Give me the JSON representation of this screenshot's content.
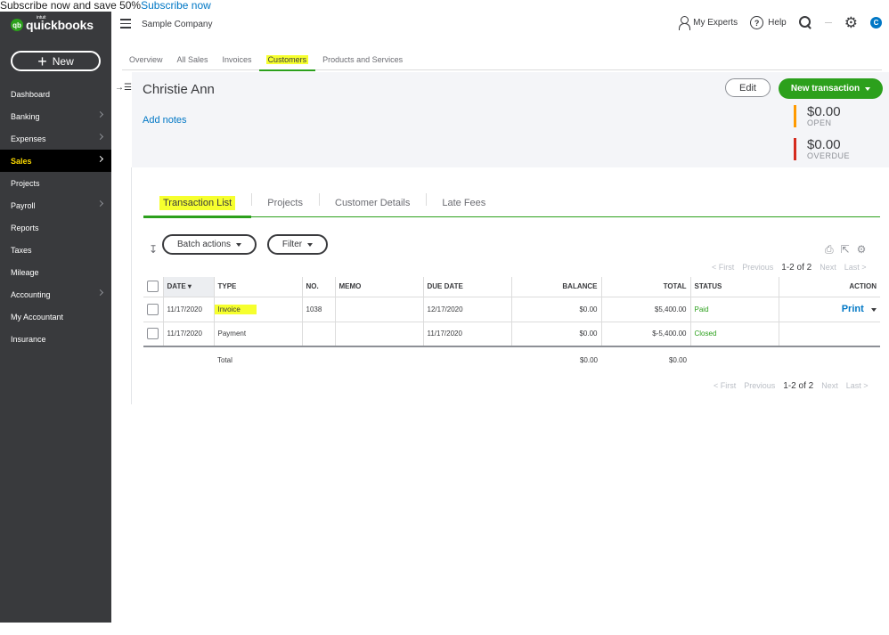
{
  "promo": {
    "text": "Subscribe now and save 50%",
    "link": "Subscribe now"
  },
  "brand": {
    "logo": "quickbooks",
    "intuit": "intuit",
    "badge": "qb"
  },
  "sidebar": {
    "new_button": "New",
    "items": [
      {
        "label": "Dashboard",
        "chevron": false
      },
      {
        "label": "Banking",
        "chevron": true
      },
      {
        "label": "Expenses",
        "chevron": true
      },
      {
        "label": "Sales",
        "chevron": true,
        "active": true
      },
      {
        "label": "Projects",
        "chevron": false
      },
      {
        "label": "Payroll",
        "chevron": true
      },
      {
        "label": "Reports",
        "chevron": false
      },
      {
        "label": "Taxes",
        "chevron": false
      },
      {
        "label": "Mileage",
        "chevron": false
      },
      {
        "label": "Accounting",
        "chevron": true
      },
      {
        "label": "My Accountant",
        "chevron": false
      },
      {
        "label": "Insurance",
        "chevron": false
      }
    ]
  },
  "topbar": {
    "company": "Sample Company",
    "my_experts": "My Experts",
    "help": "Help",
    "avatar_initial": "C"
  },
  "subtabs": [
    "Overview",
    "All Sales",
    "Invoices",
    "Customers",
    "Products and Services"
  ],
  "customer": {
    "name": "Christie Ann",
    "add_notes": "Add notes",
    "edit_button": "Edit",
    "new_transaction_button": "New transaction",
    "open_amount": "$0.00",
    "open_label": "OPEN",
    "overdue_amount": "$0.00",
    "overdue_label": "OVERDUE"
  },
  "tabs": [
    "Transaction List",
    "Projects",
    "Customer Details",
    "Late Fees"
  ],
  "toolbar": {
    "batch_actions": "Batch actions",
    "filter": "Filter"
  },
  "pager": {
    "first": "< First",
    "previous": "Previous",
    "count": "1-2 of 2",
    "next": "Next",
    "last": "Last >"
  },
  "table": {
    "headers": {
      "date": "DATE",
      "type": "TYPE",
      "no": "NO.",
      "memo": "MEMO",
      "due_date": "DUE DATE",
      "balance": "BALANCE",
      "total": "TOTAL",
      "status": "STATUS",
      "action": "ACTION"
    },
    "rows": [
      {
        "date": "11/17/2020",
        "type": "Invoice",
        "no": "1038",
        "memo": "",
        "due_date": "12/17/2020",
        "balance": "$0.00",
        "total": "$5,400.00",
        "status": "Paid",
        "action": "Print"
      },
      {
        "date": "11/17/2020",
        "type": "Payment",
        "no": "",
        "memo": "",
        "due_date": "11/17/2020",
        "balance": "$0.00",
        "total": "$-5,400.00",
        "status": "Closed",
        "action": ""
      }
    ],
    "total_row": {
      "label": "Total",
      "balance": "$0.00",
      "total": "$0.00"
    }
  },
  "colors": {
    "brand_green": "#2ca01c",
    "sidebar": "#393a3d",
    "link_blue": "#0077c5",
    "highlight": "#f6ff2e",
    "open_bar": "#ff9a00",
    "overdue_bar": "#d52b1e"
  }
}
